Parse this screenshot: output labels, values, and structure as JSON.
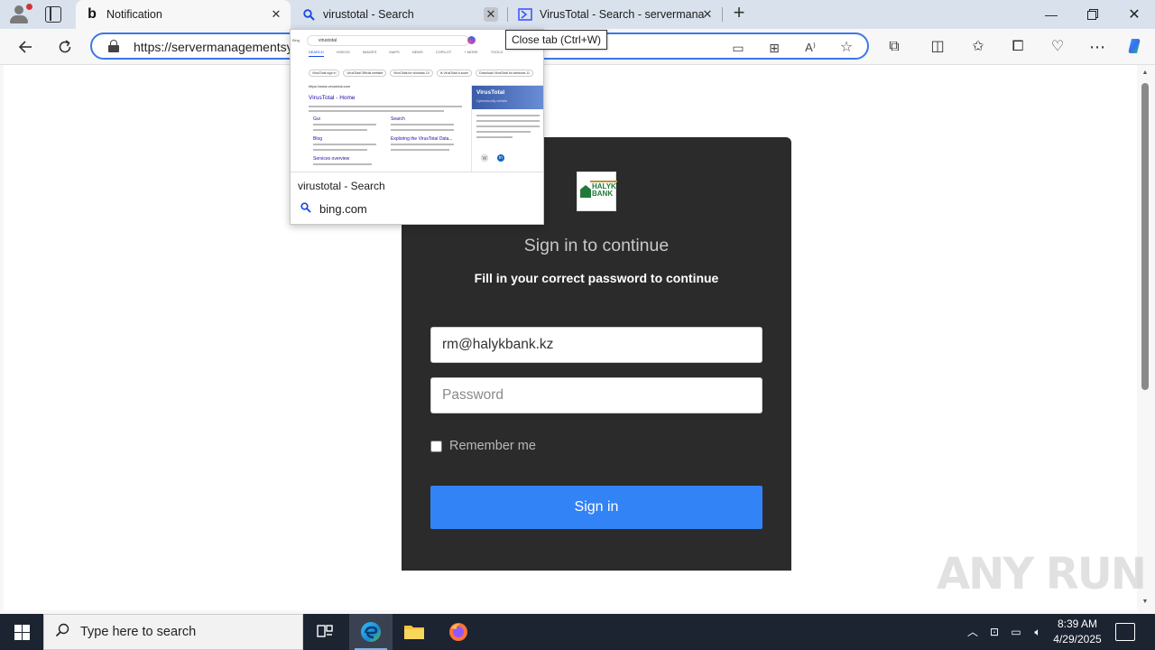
{
  "browser": {
    "tabs": [
      {
        "label": "Notification",
        "icon": "bing-b-icon",
        "active": true
      },
      {
        "label": "virustotal - Search",
        "icon": "search-icon",
        "active": false
      },
      {
        "label": "VirusTotal - Search - servermana",
        "icon": "virustotal-icon",
        "active": false
      }
    ],
    "tooltip": "Close tab (Ctrl+W)",
    "url": "https://servermanagementsy",
    "hover_card": {
      "title": "virustotal - Search",
      "site": "bing.com",
      "thumb": {
        "query": "virustotal",
        "nav": [
          "SEARCH",
          "VIDEOS",
          "IMAGES",
          "MAPS",
          "NEWS",
          "COPILOT",
          "+ MORE",
          "TOOLS"
        ],
        "chips": [
          "VirusTotal sign in",
          "VirusTotal Official website",
          "VirusTotal for windows 10",
          "Is VirusTotal a scam",
          "Download VirusTotal for windows 11"
        ],
        "result_url": "https://www.virustotal.com",
        "result_title": "VirusTotal - Home",
        "sublinks": [
          "Gui",
          "Search",
          "Blog",
          "Exploring the VirusTotal Data...",
          "Services overview"
        ],
        "panel_title": "VirusTotal",
        "panel_sub": "Cybersecurity website"
      }
    }
  },
  "page": {
    "title": "Sign in to continue",
    "subtitle": "Fill in your correct password to continue",
    "email_value": "rm@halykbank.kz",
    "password_placeholder": "Password",
    "remember_label": "Remember me",
    "signin_label": "Sign in",
    "logo_text_1": "HALYK",
    "logo_text_2": "BANK",
    "watermark": "ANY RUN"
  },
  "taskbar": {
    "search_placeholder": "Type here to search",
    "time": "8:39 AM",
    "date": "4/29/2025"
  },
  "colors": {
    "accent": "#3283f6",
    "card_bg": "#2b2b2b",
    "tab_strip": "#d9e2ec",
    "taskbar": "#1c2331"
  }
}
